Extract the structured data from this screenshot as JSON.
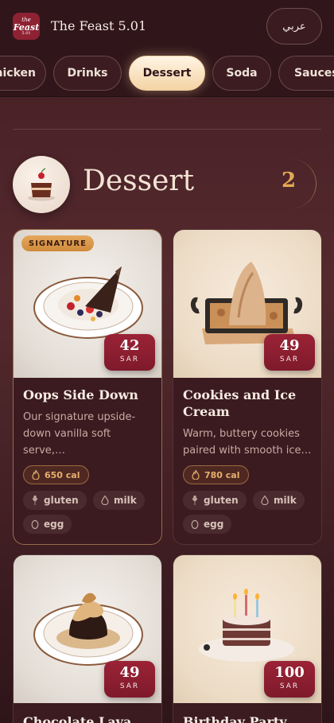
{
  "header": {
    "logo": "the Feast 5.01",
    "title": "The Feast 5.01",
    "language_button": "عربي"
  },
  "tabs": [
    {
      "label": "Chicken",
      "active": false
    },
    {
      "label": "Drinks",
      "active": false
    },
    {
      "label": "Dessert",
      "active": true
    },
    {
      "label": "Soda",
      "active": false
    },
    {
      "label": "Sauces",
      "active": false
    }
  ],
  "section": {
    "title": "Dessert",
    "count": "2",
    "icon": "cake-icon"
  },
  "items": [
    {
      "badge": "SIGNATURE",
      "name": "Oops Side Down",
      "description": "Our signature upside-down vanilla soft serve,…",
      "price": "42",
      "currency": "SAR",
      "calories": "650 cal",
      "allergens": [
        "gluten",
        "milk",
        "egg"
      ]
    },
    {
      "name": "Cookies and Ice Cream",
      "description": "Warm, buttery cookies paired with smooth ice…",
      "price": "49",
      "currency": "SAR",
      "calories": "780 cal",
      "allergens": [
        "gluten",
        "milk",
        "egg"
      ]
    },
    {
      "name": "Chocolate Lava",
      "price": "49",
      "currency": "SAR"
    },
    {
      "name": "Birthday Party",
      "price": "100",
      "currency": "SAR"
    }
  ],
  "colors": {
    "accent": "#8e2233",
    "gold": "#e3a955",
    "background": "#4a2227"
  }
}
